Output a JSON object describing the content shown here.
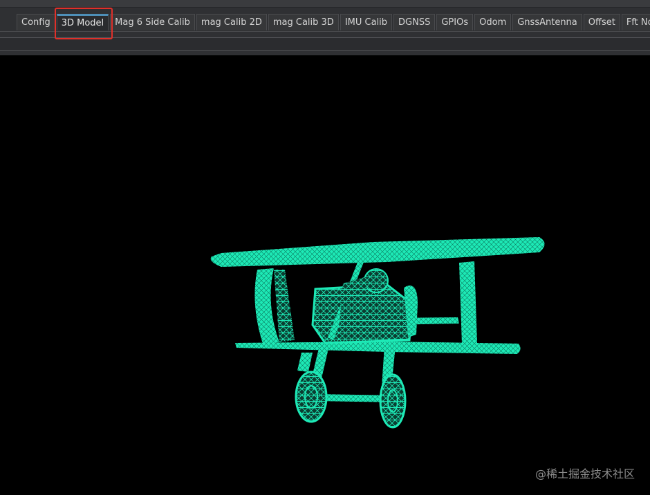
{
  "tabs": [
    {
      "label": "Config",
      "active": false
    },
    {
      "label": "3D Model",
      "active": true
    },
    {
      "label": "Mag 6 Side Calib",
      "active": false
    },
    {
      "label": "mag Calib 2D",
      "active": false
    },
    {
      "label": "mag Calib 3D",
      "active": false
    },
    {
      "label": "IMU Calib",
      "active": false
    },
    {
      "label": "DGNSS",
      "active": false
    },
    {
      "label": "GPIOs",
      "active": false
    },
    {
      "label": "Odom",
      "active": false
    },
    {
      "label": "GnssAntenna",
      "active": false
    },
    {
      "label": "Offset",
      "active": false
    },
    {
      "label": "Fft No",
      "active": false
    }
  ],
  "viewport": {
    "model": "biplane-wireframe",
    "model_color": "#1de9b6",
    "background": "#000000"
  },
  "watermark": "@稀土掘金技术社区",
  "colors": {
    "highlight": "#e0302a",
    "active_tab_accent": "#4e8fb8"
  }
}
